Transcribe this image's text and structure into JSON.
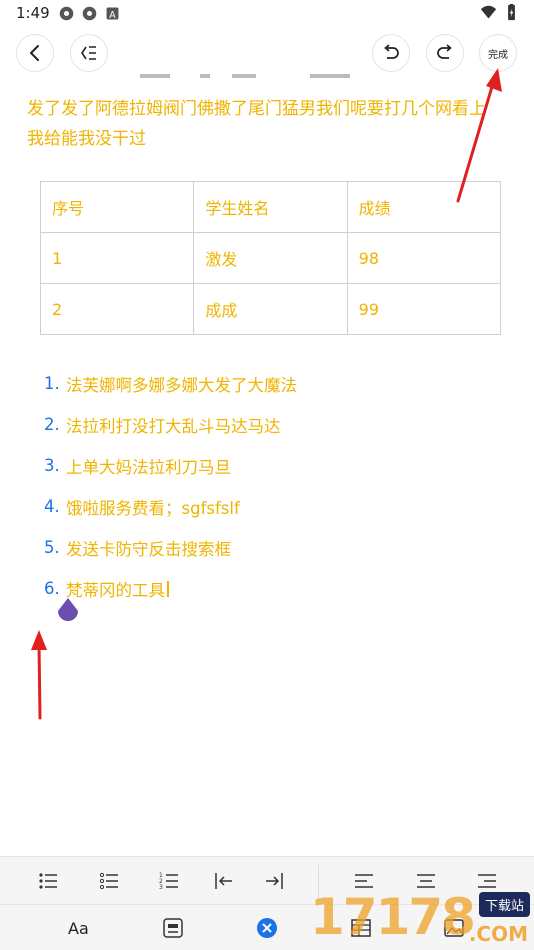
{
  "status_bar": {
    "time": "1:49",
    "left_icons": [
      "app-icon",
      "app-icon",
      "notification-a-icon"
    ],
    "right_icons": [
      "wifi-icon",
      "battery-icon"
    ]
  },
  "toolbar": {
    "back_icon": "back-arrow-icon",
    "outline_icon": "outline-list-icon",
    "undo_icon": "undo-icon",
    "redo_icon": "redo-icon",
    "done_label": "完成"
  },
  "document": {
    "paragraph": "发了发了阿德拉姆阀门佛撒了尾门猛男我们呢要打几个网看上我给能我没干过",
    "table": {
      "rows": [
        [
          "序号",
          "学生姓名",
          "成绩"
        ],
        [
          "1",
          "激发",
          "98"
        ],
        [
          "2",
          "成成",
          "99"
        ]
      ]
    },
    "list": [
      {
        "num": "1.",
        "text": "法芙娜啊多娜多娜大发了大魔法"
      },
      {
        "num": "2.",
        "text": "法拉利打没打大乱斗马达马达"
      },
      {
        "num": "3.",
        "text": "上单大妈法拉利刀马旦"
      },
      {
        "num": "4.",
        "text": "饿啦服务费看；sgfsfslf"
      },
      {
        "num": "5.",
        "text": "发送卡防守反击搜索框"
      },
      {
        "num": "6.",
        "text": "梵蒂冈的工具"
      }
    ]
  },
  "format_bar": {
    "icons": [
      "bullet-list-icon",
      "hollow-bullet-list-icon",
      "numbered-list-icon",
      "outdent-icon",
      "indent-icon",
      "align-left-icon",
      "align-center-icon",
      "align-right-icon"
    ]
  },
  "main_bar": {
    "font_label": "Aa",
    "icons": [
      "template-icon",
      "close-circle-icon",
      "table-icon",
      "image-icon"
    ]
  },
  "watermark": {
    "digits": "17178",
    "badge": "下载站",
    "suffix": ".COM"
  },
  "colors": {
    "text_accent": "#f0b400",
    "list_number": "#1a73e8",
    "cursor": "#6a4fb0",
    "arrow": "#e02020"
  }
}
